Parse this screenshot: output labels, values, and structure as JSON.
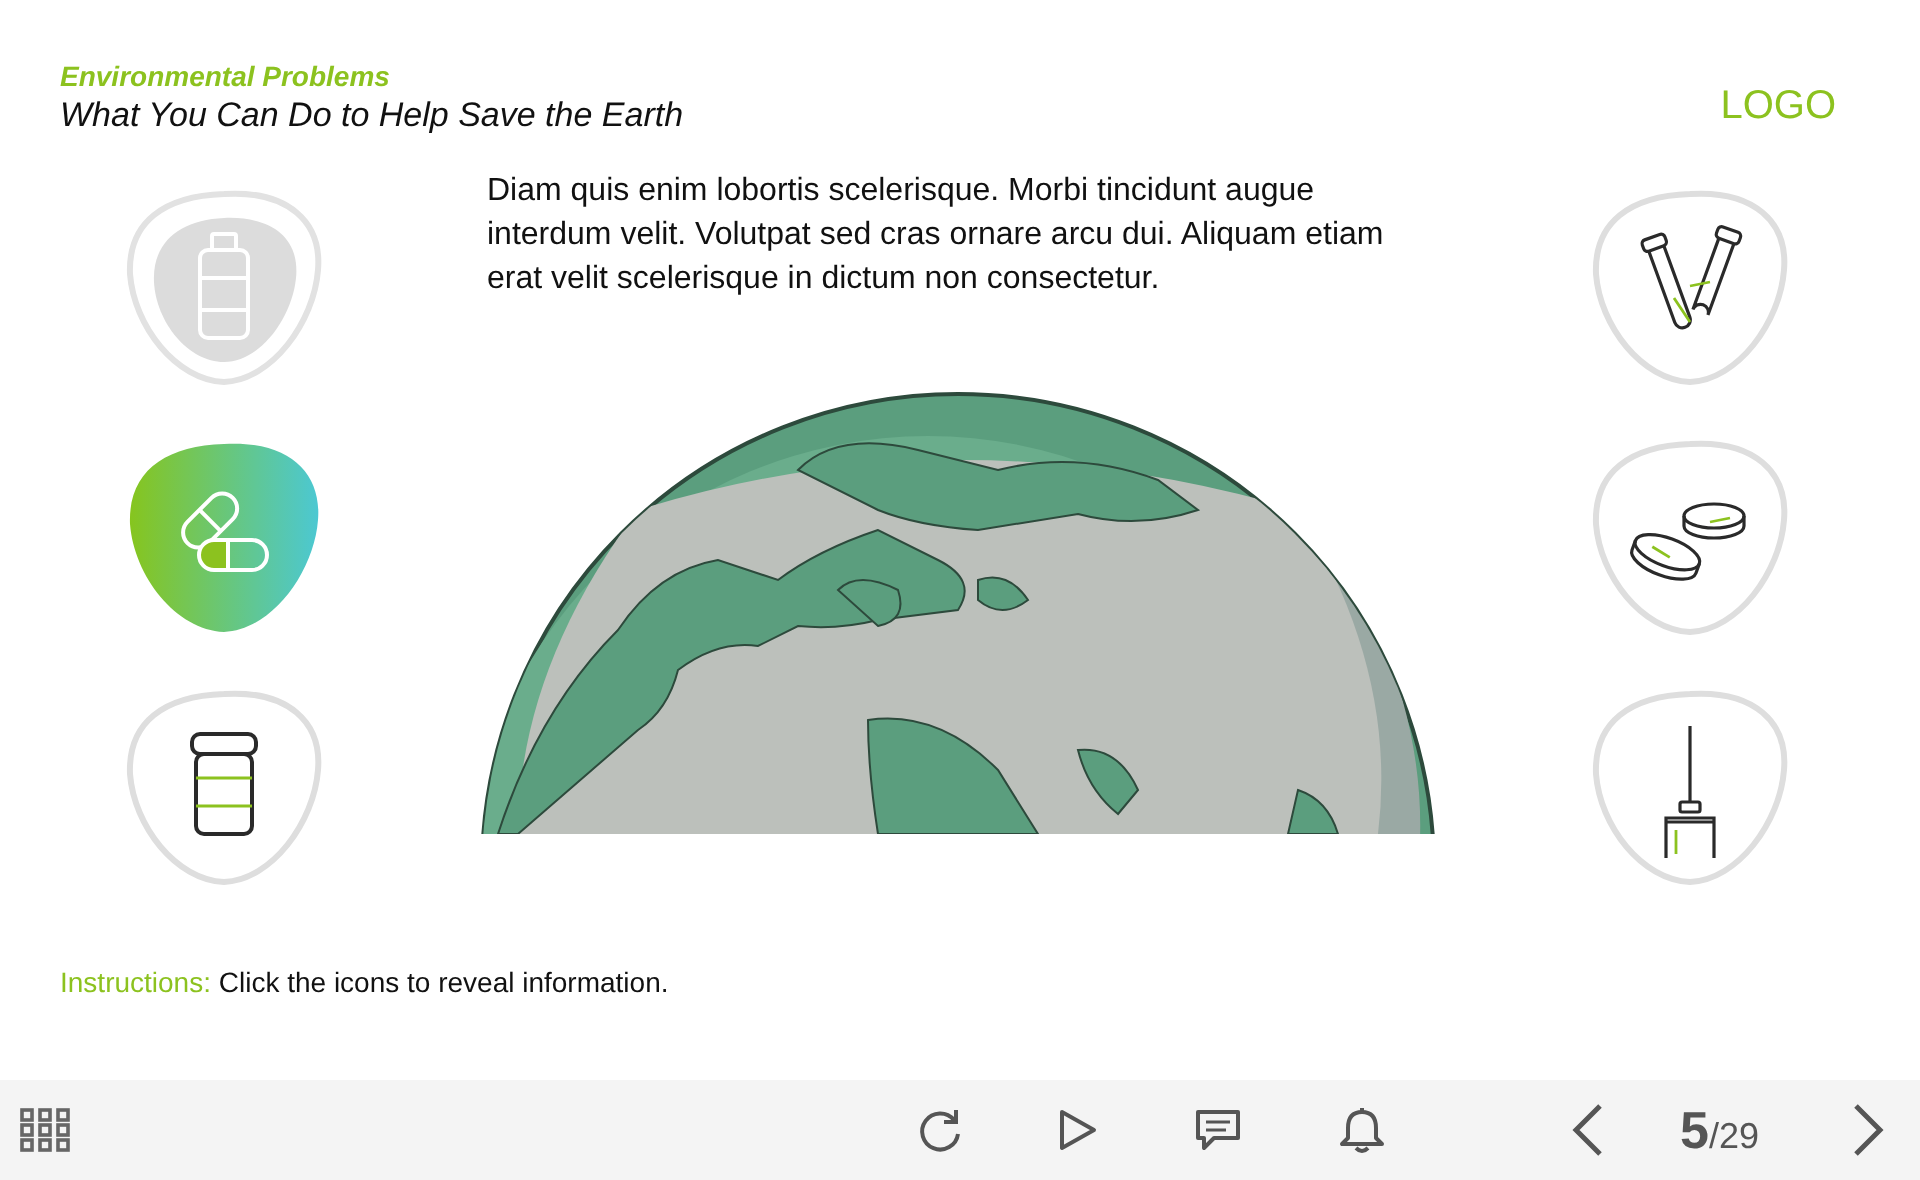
{
  "header": {
    "category": "Environmental Problems",
    "title": "What You Can Do to Help Save the Earth",
    "logo": "LOGO"
  },
  "tiles_left": [
    {
      "kind": "bottle",
      "selected": false,
      "visited": true
    },
    {
      "kind": "pills",
      "selected": true,
      "visited": false
    },
    {
      "kind": "jar",
      "selected": false,
      "visited": false
    }
  ],
  "tiles_right": [
    {
      "kind": "test-tubes",
      "selected": false,
      "visited": false
    },
    {
      "kind": "petri-dishes",
      "selected": false,
      "visited": false
    },
    {
      "kind": "syringe",
      "selected": false,
      "visited": false
    }
  ],
  "body_text": "Diam quis enim lobortis scelerisque. Morbi tincidunt augue interdum velit. Volutpat sed cras ornare arcu dui. Aliquam etiam erat velit scelerisque in dictum non consectetur.",
  "instructions": {
    "label": "Instructions:",
    "text": "Click the icons to reveal information."
  },
  "footer": {
    "page": "5",
    "total": "/29"
  }
}
